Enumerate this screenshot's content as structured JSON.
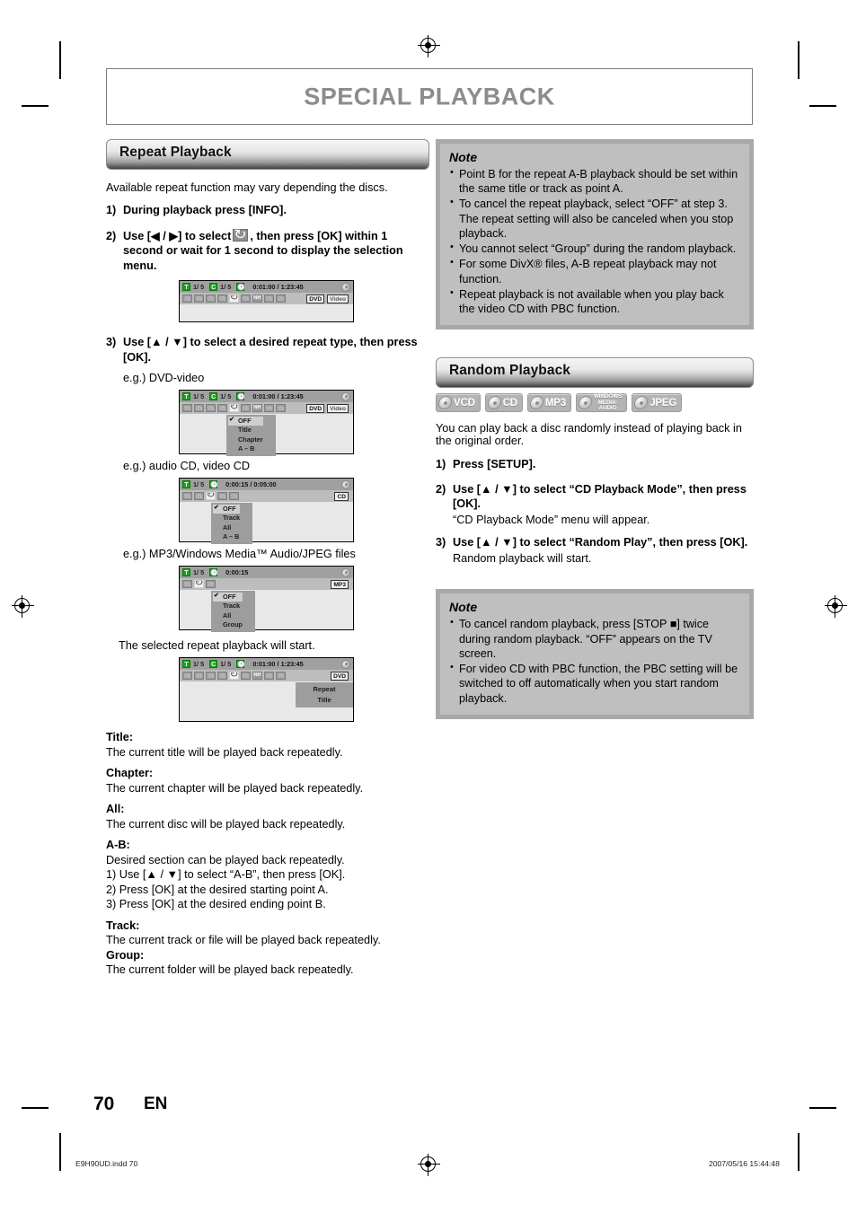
{
  "page": {
    "title": "SPECIAL PLAYBACK",
    "number": "70",
    "language": "EN",
    "footer_left": "E9H90UD.indd   70",
    "footer_right": "2007/05/16   15:44:48",
    "colors": {
      "title_gray": "#8c8c8c",
      "note_bg": "#bfbfbf",
      "note_border": "#a8a8a8",
      "osd_green": "#18a318"
    }
  },
  "repeat_section": {
    "heading": "Repeat Playback",
    "lead": "Available repeat function may vary depending the discs.",
    "steps": [
      {
        "num": "1)",
        "text": "During playback press [INFO]."
      },
      {
        "num": "2)",
        "text_before": "Use [◀ / ▶] to select",
        "icon": "repeat-icon",
        "text_after": ", then press [OK] within 1 second or wait for 1 second to display the selection menu."
      },
      {
        "num": "3)",
        "text": "Use [▲ / ▼] to select a desired repeat type, then press [OK]."
      }
    ],
    "examples": [
      "e.g.) DVD-video",
      "e.g.) audio CD, video CD",
      "e.g.) MP3/Windows Media™ Audio/JPEG files"
    ],
    "after_text": "The selected repeat playback will start.",
    "definitions": [
      {
        "term": "Title:",
        "desc": "The current title will be played back repeatedly."
      },
      {
        "term": "Chapter:",
        "desc": "The current chapter will be played back repeatedly."
      },
      {
        "term": "All:",
        "desc": "The current disc will be played back repeatedly."
      },
      {
        "term": "A-B:",
        "desc": "Desired section can be played back repeatedly.",
        "sub": [
          "1) Use [▲ / ▼] to select “A-B”, then press [OK].",
          "2) Press [OK] at the desired starting point A.",
          "3) Press [OK] at the desired ending point B."
        ]
      },
      {
        "term": "Track:",
        "desc": "The current track or file will be played back repeatedly."
      },
      {
        "term": "Group:",
        "desc": "The current folder will be played back repeatedly."
      }
    ]
  },
  "osd_panels": [
    {
      "id": "osd-info-bar",
      "title_flag": "T",
      "title_count": "1/  5",
      "chapter_flag": "C",
      "chapter_count": "1/  5",
      "clock_flag": "◔",
      "time": "0:01:00 / 1:23:45",
      "icon_count": 9,
      "repeat_icon_index": 5,
      "badges": [
        "DVD",
        "Video"
      ],
      "menu": null
    },
    {
      "id": "osd-dvd-video",
      "title_flag": "T",
      "title_count": "1/  5",
      "chapter_flag": "C",
      "chapter_count": "1/  5",
      "clock_flag": "◔",
      "time": "0:01:00 / 1:23:45",
      "icon_count": 9,
      "repeat_icon_index": 5,
      "badges": [
        "DVD",
        "Video"
      ],
      "menu": {
        "selected": "OFF",
        "items": [
          "OFF",
          "Title",
          "Chapter",
          "A – B"
        ]
      }
    },
    {
      "id": "osd-audio-cd",
      "title_flag": "T",
      "title_count": "1/  5",
      "chapter_flag": null,
      "chapter_count": null,
      "clock_flag": "◔",
      "time": "0:00:15 / 0:05:00",
      "icon_count": 5,
      "repeat_icon_index": 3,
      "badges": [
        "CD"
      ],
      "menu": {
        "selected": "OFF",
        "items": [
          "OFF",
          "Track",
          "All",
          "A – B"
        ]
      }
    },
    {
      "id": "osd-mp3",
      "title_flag": "T",
      "title_count": "1/  5",
      "chapter_flag": null,
      "chapter_count": null,
      "clock_flag": "◔",
      "time": "0:00:15",
      "icon_count": 3,
      "repeat_icon_index": 2,
      "badges": [
        "MP3"
      ],
      "menu": {
        "selected": "OFF",
        "items": [
          "OFF",
          "Track",
          "All",
          "Group"
        ]
      }
    },
    {
      "id": "osd-repeat-title",
      "title_flag": "T",
      "title_count": "1/  5",
      "chapter_flag": "C",
      "chapter_count": "1/  5",
      "clock_flag": "◔",
      "time": "0:01:00 / 1:23:45",
      "icon_count": 9,
      "repeat_icon_index": 5,
      "badges": [
        "DVD"
      ],
      "info": {
        "line1": "Repeat",
        "line2": "Title"
      }
    }
  ],
  "note_repeat": {
    "heading": "Note",
    "items": [
      "Point B for the repeat A-B playback should be set within the same title or track as point A.",
      "To cancel the repeat playback, select “OFF” at step 3. The repeat setting will also be canceled when you stop playback.",
      "You cannot select “Group” during the random playback.",
      "For some DivX® files, A-B repeat playback may not function.",
      "Repeat playback is not available when you play back the video CD with PBC function."
    ]
  },
  "random_section": {
    "heading": "Random Playback",
    "disc_types": [
      {
        "label": "VCD",
        "multiline": false
      },
      {
        "label": "CD",
        "multiline": false
      },
      {
        "label": "MP3",
        "multiline": false
      },
      {
        "label": "WINDOWS\nMEDIA·\nAUDIO",
        "multiline": true
      },
      {
        "label": "JPEG",
        "multiline": false
      }
    ],
    "lead": "You can play back a disc randomly instead of playing back in the original order.",
    "steps": [
      {
        "num": "1)",
        "text": "Press [SETUP].",
        "sub": null
      },
      {
        "num": "2)",
        "text": "Use [▲ / ▼] to select “CD Playback Mode”, then press [OK].",
        "sub": "“CD Playback Mode” menu will appear."
      },
      {
        "num": "3)",
        "text": "Use [▲ / ▼] to select “Random Play”, then press [OK].",
        "sub": "Random playback will start."
      }
    ]
  },
  "note_random": {
    "heading": "Note",
    "items": [
      "To cancel random playback, press [STOP ■] twice during random playback. “OFF” appears on the TV screen.",
      "For video CD with PBC function, the PBC setting will be switched to off automatically when you start random playback."
    ]
  }
}
